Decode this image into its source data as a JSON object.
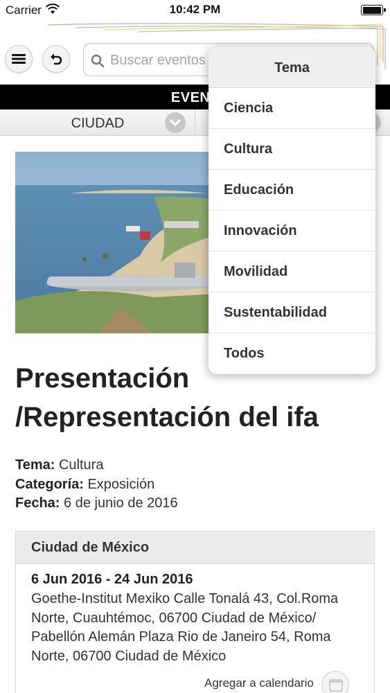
{
  "status_bar": {
    "carrier": "Carrier",
    "time": "10:42 PM",
    "battery_level": 1.0
  },
  "header": {
    "menu_icon": "hamburger-icon",
    "back_icon": "undo-arrow-icon",
    "search": {
      "placeholder": "Buscar eventos",
      "value": "",
      "icon": "search-icon"
    }
  },
  "section_bar": {
    "title_visible": "EVENT"
  },
  "filters": {
    "city_label": "CIUDAD",
    "chevron_icon": "chevron-down-icon"
  },
  "event": {
    "title": "Presentación /Representación del ifa",
    "tema_label": "Tema:",
    "tema_value": "Cultura",
    "categoria_label": "Categoría:",
    "categoria_value": "Exposición",
    "fecha_label": "Fecha:",
    "fecha_value": "6 de junio de 2016"
  },
  "location": {
    "city": "Ciudad de México",
    "dates": "6 Jun 2016 - 24 Jun 2016",
    "address": "Goethe-Institut Mexiko Calle Tonalá 43, Col.Roma Norte, Cuauhtémoc, 06700 Ciudad de México/ Pabellón Alemán Plaza Rio de Janeiro 54, Roma Norte, 06700 Ciudad de México",
    "add_calendar": "Agregar a calendario",
    "calendar_icon": "calendar-icon"
  },
  "dropdown": {
    "title": "Tema",
    "items": [
      "Ciencia",
      "Cultura",
      "Educación",
      "Innovación",
      "Movilidad",
      "Sustentabilidad",
      "Todos"
    ]
  },
  "colors": {
    "accent_black": "#000000",
    "text_dark": "#222222",
    "card_header_bg": "#ebebeb"
  }
}
